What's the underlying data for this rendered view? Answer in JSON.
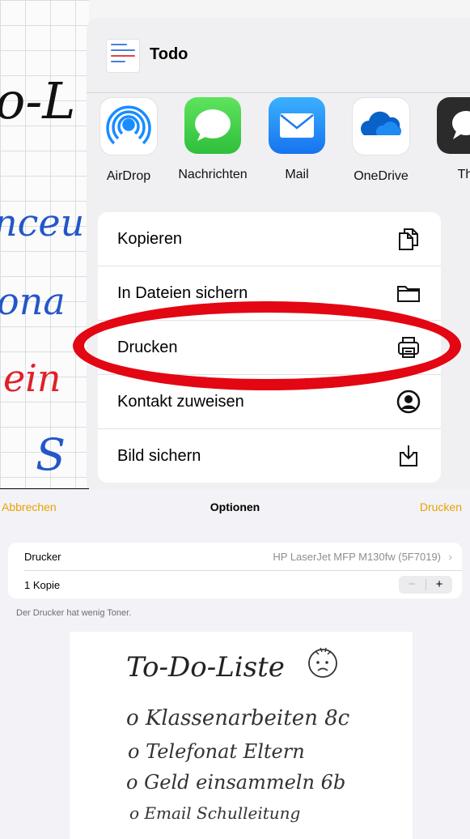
{
  "share_sheet": {
    "title": "Todo",
    "apps": [
      {
        "label": "AirDrop",
        "icon": "airdrop-icon",
        "color": "#1a8cff"
      },
      {
        "label": "Nachrichten",
        "icon": "messages-icon",
        "color": "#34c759"
      },
      {
        "label": "Mail",
        "icon": "mail-icon",
        "color": "#1e88ff"
      },
      {
        "label": "OneDrive",
        "icon": "onedrive-icon",
        "color": "#0a62c9"
      },
      {
        "label": "Th",
        "icon": "threema-icon",
        "color": "#2b2b2b"
      }
    ],
    "actions": [
      {
        "label": "Kopieren",
        "icon": "copy-icon"
      },
      {
        "label": "In Dateien sichern",
        "icon": "folder-icon"
      },
      {
        "label": "Drucken",
        "icon": "printer-icon"
      },
      {
        "label": "Kontakt zuweisen",
        "icon": "contact-icon"
      },
      {
        "label": "Bild sichern",
        "icon": "save-image-icon"
      }
    ],
    "highlight_color": "#e30613"
  },
  "background_note": {
    "fragments": [
      "o-L",
      "nceu",
      "ona",
      "ein",
      "S"
    ]
  },
  "print_options": {
    "cancel_label": "Abbrechen",
    "title": "Optionen",
    "print_label": "Drucken",
    "accent_color": "#e8a300",
    "printer_label": "Drucker",
    "printer_value": "HP LaserJet MFP M130fw (5F7019)",
    "copies_label": "1 Kopie",
    "stepper_minus": "−",
    "stepper_plus": "+",
    "toner_note": "Der Drucker hat wenig Toner.",
    "preview": {
      "title": "To-Do-Liste",
      "items": [
        "o Klassenarbeiten 8c",
        "o Telefonat Eltern",
        "o Geld einsammeln 6b",
        "o Email Schulleitung"
      ]
    }
  }
}
